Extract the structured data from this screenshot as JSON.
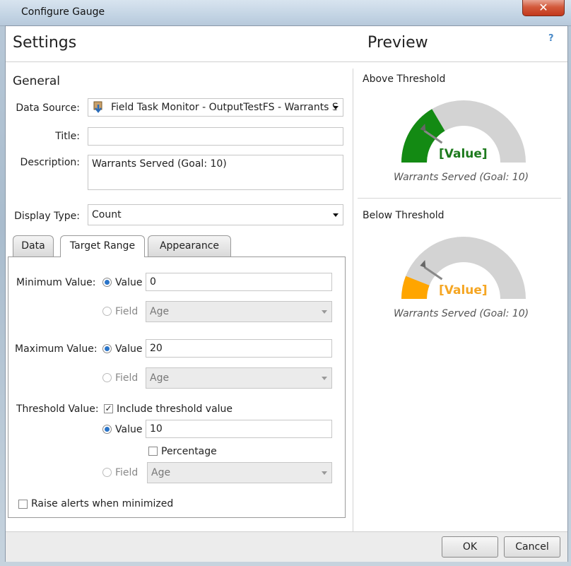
{
  "window": {
    "title": "Configure Gauge",
    "close_glyph": "✕"
  },
  "header": {
    "settings": "Settings",
    "preview": "Preview",
    "help": "?"
  },
  "general": {
    "heading": "General",
    "data_source_label": "Data Source:",
    "data_source_value": "Field Task Monitor - OutputTestFS - Warrants S",
    "data_source_icon": "layer-download-icon",
    "title_label": "Title:",
    "title_value": "",
    "description_label": "Description:",
    "description_value": "Warrants Served (Goal: 10)",
    "display_type_label": "Display Type:",
    "display_type_value": "Count"
  },
  "tabs": [
    {
      "label": "Data",
      "active": false
    },
    {
      "label": "Target Range",
      "active": true
    },
    {
      "label": "Appearance",
      "active": false
    }
  ],
  "target_range": {
    "minimum_label": "Minimum Value:",
    "maximum_label": "Maximum Value:",
    "threshold_label": "Threshold Value:",
    "value_label": "Value",
    "field_label": "Field",
    "min_value": "0",
    "min_field": "Age",
    "max_value": "20",
    "max_field": "Age",
    "include_threshold_label": "Include threshold value",
    "threshold_value": "10",
    "percentage_label": "Percentage",
    "threshold_field": "Age",
    "raise_alerts_label": "Raise alerts when minimized"
  },
  "preview": {
    "above": {
      "heading": "Above Threshold",
      "value_text": "[Value]",
      "caption": "Warrants Served (Goal: 10)",
      "color": "#138a13",
      "text_color": "#1d7a1d",
      "fill_fraction": 0.33
    },
    "below": {
      "heading": "Below Threshold",
      "value_text": "[Value]",
      "caption": "Warrants Served (Goal: 10)",
      "color": "#ffa500",
      "text_color": "#f5a623",
      "fill_fraction": 0.12
    },
    "track_color": "#d3d3d3"
  },
  "footer": {
    "ok": "OK",
    "cancel": "Cancel"
  }
}
